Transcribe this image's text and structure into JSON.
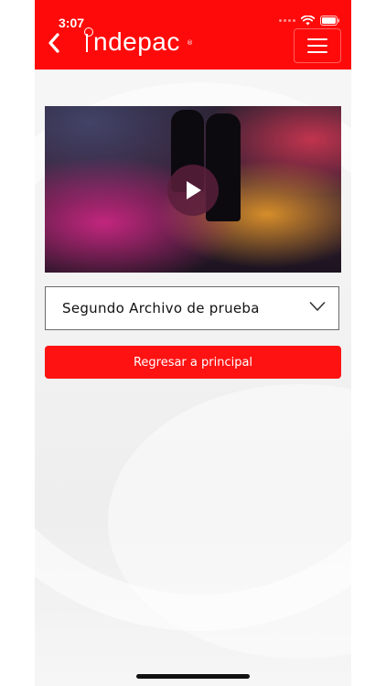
{
  "status_bar": {
    "time": "3:07"
  },
  "header": {
    "logo_text": "ndepac",
    "logo_superscript": "®",
    "back_icon": "chevron-left-icon",
    "menu_icon": "hamburger-menu-icon",
    "background_color": "#ff0a0a"
  },
  "video": {
    "play_icon": "play-icon"
  },
  "file_select": {
    "selected": "Segundo Archivo de prueba",
    "icon": "chevron-down-icon"
  },
  "actions": {
    "back_to_main_label": "Regresar a principal",
    "accent_color": "#ff1212"
  }
}
